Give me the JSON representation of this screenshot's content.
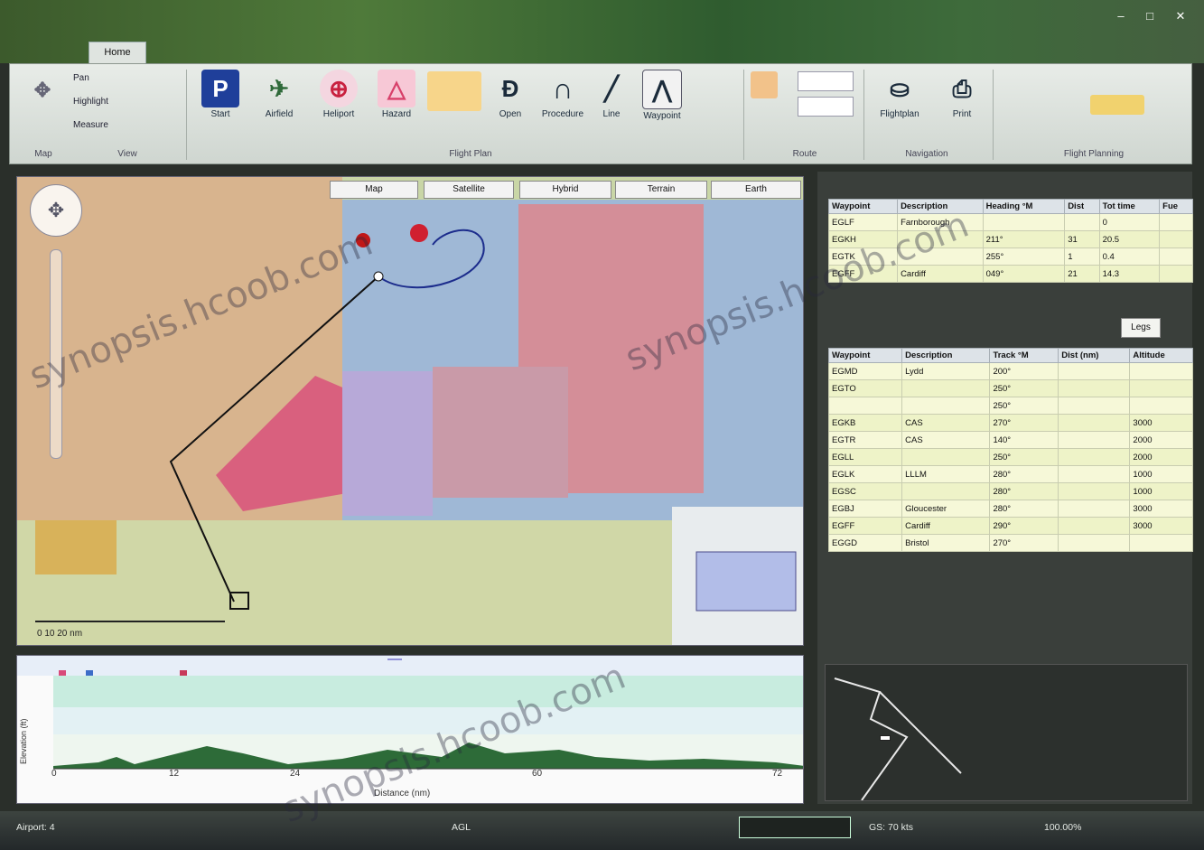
{
  "window": {
    "title": "",
    "tabs": [
      {
        "label": "Home"
      }
    ]
  },
  "ribbon": {
    "left_items": [
      {
        "label": "Pan"
      },
      {
        "label": "Highlight"
      },
      {
        "label": "Measure"
      }
    ],
    "buttons": [
      {
        "label": "Start",
        "icon_glyph": "P"
      },
      {
        "label": "Airfield",
        "icon_glyph": "✈"
      },
      {
        "label": "Heliport",
        "icon_glyph": "⊕"
      },
      {
        "label": "Hazard",
        "icon_glyph": "△"
      },
      {
        "label": "Open",
        "icon_glyph": "Ɖ"
      },
      {
        "label": "Procedure",
        "icon_glyph": "∩"
      },
      {
        "label": "Line",
        "icon_glyph": "╱"
      },
      {
        "label": "Waypoint",
        "icon_glyph": "⋀"
      }
    ],
    "right_buttons": [
      {
        "label": "Flightplan",
        "icon_glyph": "⛀"
      },
      {
        "label": "Print",
        "icon_glyph": "⎙"
      }
    ],
    "groups": [
      {
        "label": "Map"
      },
      {
        "label": "View"
      },
      {
        "label": "Flight Plan"
      },
      {
        "label": "Route"
      },
      {
        "label": "Navigation"
      },
      {
        "label": "Flight Planning"
      }
    ],
    "colors": {
      "accent": "#1f3f9a",
      "hazard": "#d8406a"
    }
  },
  "map": {
    "tabs": [
      {
        "label": "Map"
      },
      {
        "label": "Satellite"
      },
      {
        "label": "Hybrid"
      },
      {
        "label": "Terrain"
      },
      {
        "label": "Earth"
      }
    ],
    "scale_text": "0  10  20 nm",
    "footer_text": ""
  },
  "table1": {
    "headers": [
      "Waypoint",
      "Description",
      "Heading °M",
      "Dist",
      "Tot time",
      "Fue"
    ],
    "rows": [
      [
        "EGLF",
        "Farnborough",
        "",
        "",
        "0",
        ""
      ],
      [
        "EGKH",
        "",
        "211°",
        "31",
        "20.5",
        ""
      ],
      [
        "EGTK",
        "",
        "255°",
        "1",
        "0.4",
        ""
      ],
      [
        "EGFF",
        "Cardiff",
        "049°",
        "21",
        "14.3",
        ""
      ]
    ]
  },
  "table2": {
    "tab_label": "Legs",
    "headers": [
      "Waypoint",
      "Description",
      "Track °M",
      "Dist (nm)",
      "Altitude"
    ],
    "rows": [
      [
        "EGMD",
        "Lydd",
        "200°",
        "",
        ""
      ],
      [
        "EGTO",
        "",
        "250°",
        "",
        ""
      ],
      [
        "",
        "",
        "250°",
        "",
        ""
      ],
      [
        "EGKB",
        "CAS",
        "270°",
        "",
        "3000"
      ],
      [
        "EGTR",
        "CAS",
        "140°",
        "",
        "2000"
      ],
      [
        "EGLL",
        "",
        "250°",
        "",
        "2000"
      ],
      [
        "EGLK",
        "LLLM",
        "280°",
        "",
        "1000"
      ],
      [
        "EGSC",
        "",
        "280°",
        "",
        "1000"
      ],
      [
        "EGBJ",
        "Gloucester",
        "280°",
        "",
        "3000"
      ],
      [
        "EGFF",
        "Cardiff",
        "290°",
        "",
        "3000"
      ],
      [
        "EGGD",
        "Bristol",
        "270°",
        "",
        ""
      ]
    ]
  },
  "minimap": {
    "tooltip": ""
  },
  "profile": {
    "label": "",
    "ylabel": "Elevation (ft)",
    "xlabel": "Distance (nm)",
    "x_ticks": [
      "0",
      "12",
      "24",
      "",
      "60",
      "",
      "72"
    ],
    "legend": [
      {
        "label": "",
        "color": "#d94a7a"
      },
      {
        "label": "",
        "color": "#3c6cc8"
      },
      {
        "label": "",
        "color": "#c83a5a"
      }
    ]
  },
  "status": {
    "items": [
      {
        "label": "Airport: 4"
      },
      {
        "label": ""
      },
      {
        "label": ""
      },
      {
        "label": "AGL"
      },
      {
        "label": ""
      },
      {
        "label": ""
      },
      {
        "label": "GS: 70 kts"
      },
      {
        "label": "100.00%"
      }
    ]
  },
  "watermark": {
    "text": "synopsis.hcoob.com"
  }
}
